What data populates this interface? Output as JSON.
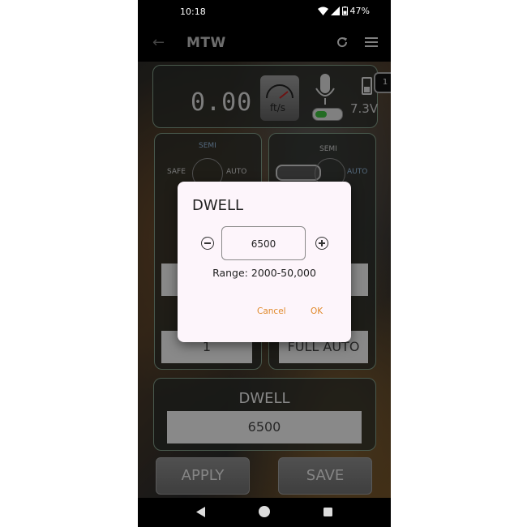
{
  "status": {
    "time": "10:18",
    "battery": "47%"
  },
  "appbar": {
    "title": "MTW",
    "back_icon": "back-arrow-icon",
    "refresh_icon": "refresh-icon",
    "menu_icon": "hamburger-menu-icon"
  },
  "header_panel": {
    "speed": "0.00",
    "speed_unit": "ft/s",
    "voltage": "7.3V",
    "badge": "1"
  },
  "selector_left": {
    "top_label": "SEMI",
    "left_label": "SAFE",
    "right_label": "AUTO",
    "value": "1"
  },
  "selector_right": {
    "top_label": "SEMI",
    "right_label": "AUTO",
    "value": "FULL AUTO"
  },
  "dwell_panel": {
    "label": "DWELL",
    "value": "6500"
  },
  "buttons": {
    "apply": "APPLY",
    "save": "SAVE"
  },
  "dialog": {
    "title": "DWELL",
    "value": "6500",
    "range": "Range: 2000-50,000",
    "cancel": "Cancel",
    "ok": "OK"
  },
  "colors": {
    "dialog_action": "#e0892a",
    "panel_border": "#7f9a85",
    "toggle_on": "#3dba3d"
  }
}
